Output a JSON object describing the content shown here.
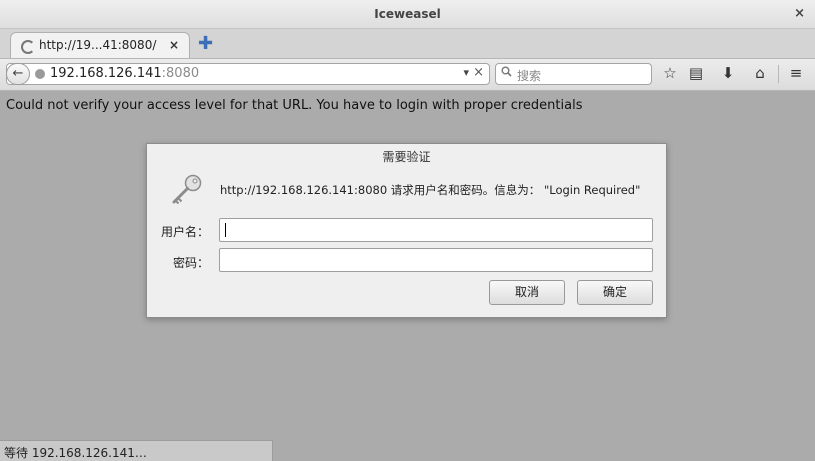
{
  "window": {
    "title": "Iceweasel",
    "close": "×"
  },
  "tabs": [
    {
      "label": "http://19...41:8080/",
      "close": "×"
    }
  ],
  "newtab": "✚",
  "navbar": {
    "back": "←",
    "url_host": "192.168.126.141",
    "url_port": ":8080",
    "dropdown": "▾",
    "clear": "×",
    "search_icon": "search-icon",
    "search_placeholder": "搜索",
    "buttons": [
      "☆",
      "▤",
      "⬇",
      "⌂",
      "≡"
    ]
  },
  "content": {
    "message": "Could not verify your access level for that URL. You have to login with proper credentials"
  },
  "dialog": {
    "title": "需要验证",
    "message": "http://192.168.126.141:8080 请求用户名和密码。信息为： \"Login Required\"",
    "username_label": "用户名：",
    "username_value": "",
    "password_label": "密码：",
    "password_value": "",
    "cancel": "取消",
    "ok": "确定"
  },
  "status": {
    "text": "等待 192.168.126.141…"
  }
}
